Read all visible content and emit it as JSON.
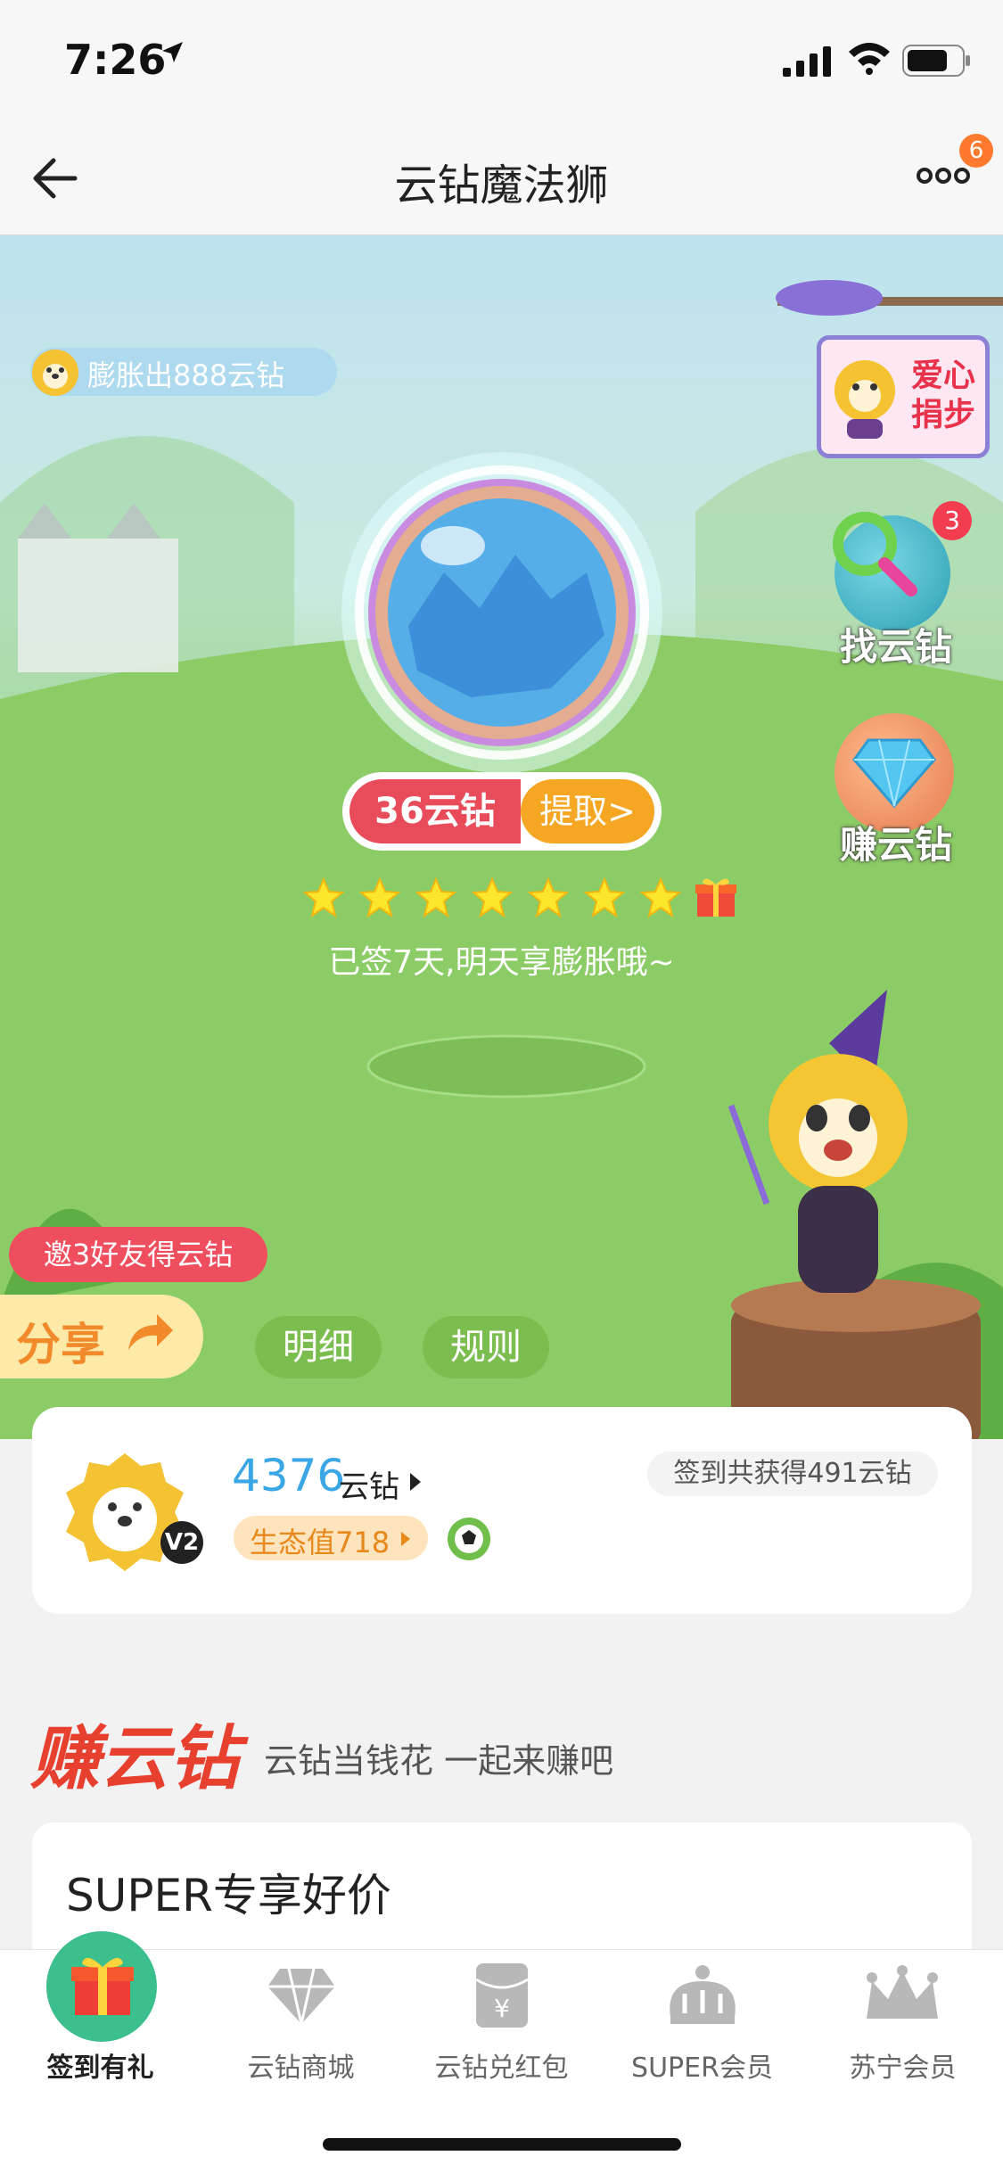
{
  "status_bar": {
    "time": "7:26"
  },
  "nav": {
    "title": "云钻魔法狮",
    "more_badge": "6"
  },
  "hero": {
    "expand_text": "膨胀出888云钻",
    "donate_label_line1": "爱心",
    "donate_label_line2": "捐步",
    "find_label": "找云钻",
    "find_badge": "3",
    "earn_label": "赚云钻",
    "coins_pill": "36云钻",
    "withdraw_label": "提取>",
    "stars_filled": 7,
    "signed_text": "已签7天,明天享膨胀哦~",
    "invite_label": "邀3好友得云钻",
    "share_label": "分享",
    "detail_label": "明细",
    "rules_label": "规则"
  },
  "user_card": {
    "level": "V2",
    "coins": "4376",
    "coins_unit": "云钻",
    "eco_value": "生态值718",
    "total_signed": "签到共获得491云钻"
  },
  "earn_section": {
    "title": "赚云钻",
    "subtitle": "云钻当钱花 一起来赚吧",
    "super_title": "SUPER专享好价"
  },
  "tabbar": {
    "items": [
      {
        "label": "签到有礼",
        "icon": "gift-icon"
      },
      {
        "label": "云钻商城",
        "icon": "diamond-icon"
      },
      {
        "label": "云钻兑红包",
        "icon": "red-envelope-icon"
      },
      {
        "label": "SUPER会员",
        "icon": "crown-icon"
      },
      {
        "label": "苏宁会员",
        "icon": "royal-crown-icon"
      }
    ]
  },
  "colors": {
    "accent_red": "#e84c5b",
    "accent_orange": "#f5a623",
    "coin_blue": "#3aa6e6",
    "tab_green": "#3bbf8d"
  }
}
